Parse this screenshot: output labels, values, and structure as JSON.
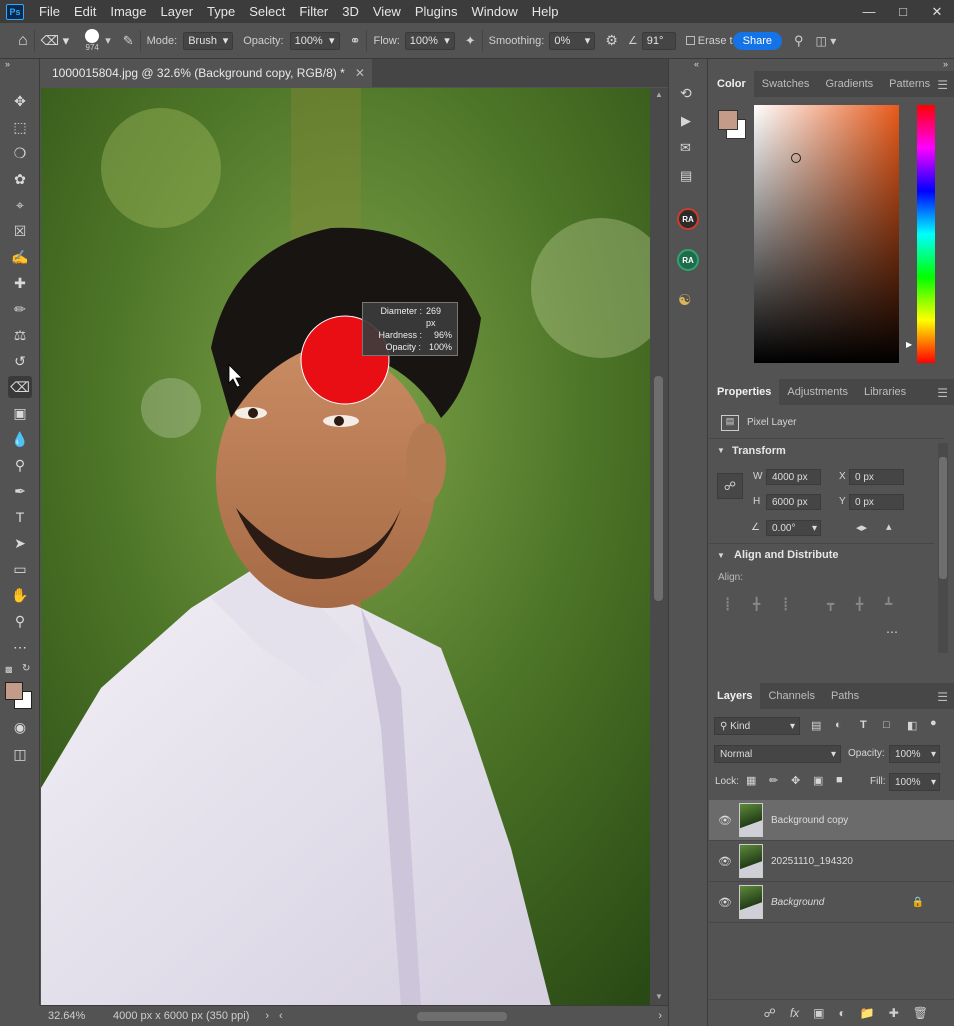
{
  "menubar": {
    "items": [
      "File",
      "Edit",
      "Image",
      "Layer",
      "Type",
      "Select",
      "Filter",
      "3D",
      "View",
      "Plugins",
      "Window",
      "Help"
    ],
    "logo": "Ps"
  },
  "options": {
    "brush_size": "974",
    "mode_label": "Mode:",
    "mode_value": "Brush",
    "opacity_label": "Opacity:",
    "opacity_value": "100%",
    "flow_label": "Flow:",
    "flow_value": "100%",
    "smoothing_label": "Smoothing:",
    "smoothing_value": "0%",
    "angle_value": "91°",
    "erase_label": "Erase t",
    "share_label": "Share"
  },
  "document": {
    "tab_title": "1000015804.jpg @ 32.6% (Background copy, RGB/8) *",
    "zoom": "32.64%",
    "dimensions": "4000 px x 6000 px (350 ppi)"
  },
  "brush_tooltip": {
    "diameter_label": "Diameter :",
    "diameter_value": "269 px",
    "hardness_label": "Hardness :",
    "hardness_value": "96%",
    "opacity_label": "Opacity :",
    "opacity_value": "100%"
  },
  "color_panel": {
    "tabs": [
      "Color",
      "Swatches",
      "Gradients",
      "Patterns"
    ],
    "foreground": "#c49a88",
    "background": "#ffffff",
    "hue_color": "#e85a1a"
  },
  "properties_panel": {
    "tabs": [
      "Properties",
      "Adjustments",
      "Libraries"
    ],
    "layer_type": "Pixel Layer",
    "transform_label": "Transform",
    "w_label": "W",
    "w_value": "4000 px",
    "h_label": "H",
    "h_value": "6000 px",
    "x_label": "X",
    "x_value": "0 px",
    "y_label": "Y",
    "y_value": "0 px",
    "angle_value": "0.00°",
    "align_section": "Align and Distribute",
    "align_label": "Align:"
  },
  "layers_panel": {
    "tabs": [
      "Layers",
      "Channels",
      "Paths"
    ],
    "filter_kind": "Kind",
    "blend_mode": "Normal",
    "opacity_label": "Opacity:",
    "opacity_value": "100%",
    "lock_label": "Lock:",
    "fill_label": "Fill:",
    "fill_value": "100%",
    "layers": [
      {
        "name": "Background copy",
        "selected": true
      },
      {
        "name": "20251110_194320",
        "selected": false
      },
      {
        "name": "Background",
        "selected": false
      }
    ]
  },
  "mid_strip": {
    "badge1": "RA",
    "badge2": "RA"
  }
}
